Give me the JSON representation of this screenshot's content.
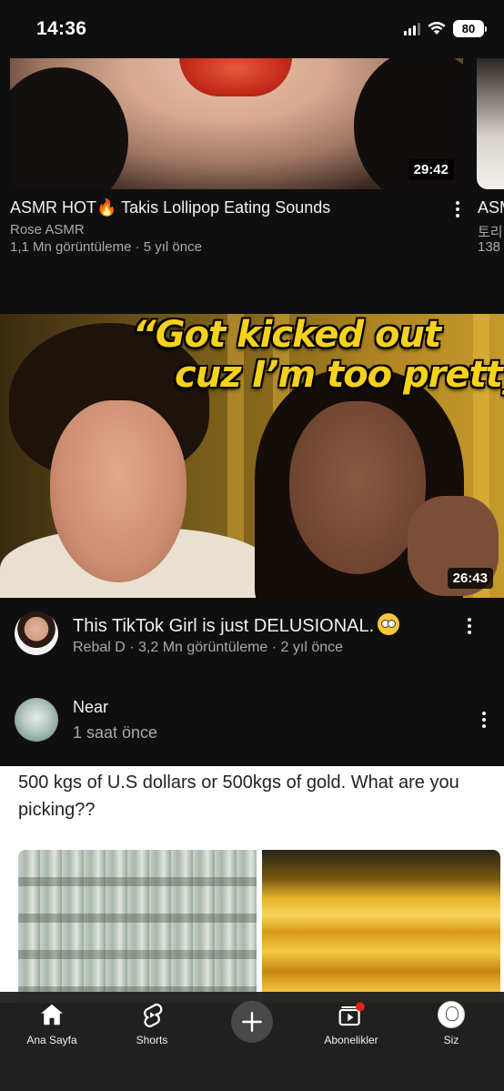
{
  "status_bar": {
    "time": "14:36",
    "battery": "80"
  },
  "row_video": {
    "duration": "29:42",
    "title": "ASMR HOT🔥 Takis Lollipop Eating Sounds",
    "channel": "Rose ASMR",
    "meta": "1,1 Mn görüntüleme · 5 yıl önce",
    "peek_title": "ASM",
    "peek_channel": "토리",
    "peek_meta": "138"
  },
  "main_video": {
    "thumbnail_text_line1": "“Got kicked out",
    "thumbnail_text_line2": "cuz I’m too pretty”",
    "duration": "26:43",
    "title": "This TikTok Girl is just DELUSIONAL.",
    "meta": "Rebal D · 3,2 Mn görüntüleme · 2 yıl önce"
  },
  "post": {
    "author": "Near",
    "time": "1 saat önce",
    "text": "500 kgs of U.S dollars  or   500kgs of gold. What are you picking??"
  },
  "bottom_nav": {
    "home": "Ana Sayfa",
    "shorts": "Shorts",
    "subscriptions": "Abonelikler",
    "you": "Siz"
  },
  "colors": {
    "background": "#0f0f0f",
    "nav_background": "#212121",
    "headline_yellow": "#f7d21c",
    "notification_red": "#e62117"
  }
}
